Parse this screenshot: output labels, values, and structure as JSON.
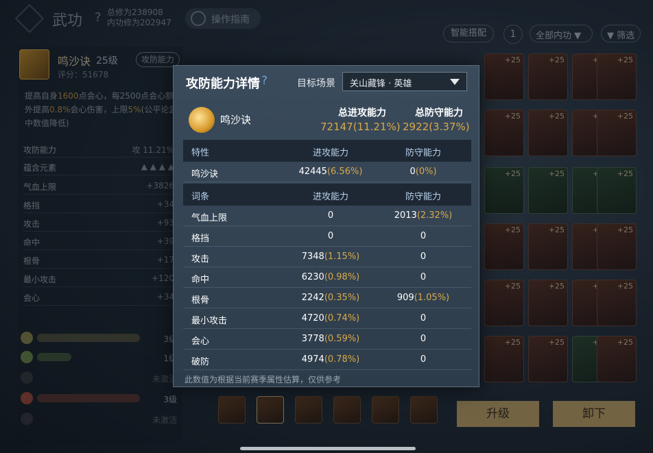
{
  "header": {
    "title": "武功",
    "help": "?",
    "total_cultivation": "总修为238908",
    "inner_cultivation": "内功修为202947",
    "guide": "操作指南"
  },
  "toolbar": {
    "smart_match": "智能搭配",
    "sort": "1",
    "all_inner": "全部内功",
    "filter": "筛选"
  },
  "skill_panel": {
    "name": "鸣沙诀",
    "level": "25级",
    "tag": "攻防能力",
    "score": "评分：51678",
    "desc_prefix": "提高自身",
    "desc_v1": "1600",
    "desc_mid": "点会心，每2500点会心额外提高",
    "desc_v2": "0.8%",
    "desc_mid2": "会心伤害，上限",
    "desc_v3": "5%",
    "desc_suffix": "(公平论武中数值降低)",
    "attack_defense_label": "攻防能力",
    "attack_defense_tag": "攻",
    "attack_defense_value": "11.21%",
    "elements_label": "蕴含元素",
    "stats": [
      {
        "k": "气血上限",
        "v": "+3826"
      },
      {
        "k": "格挡",
        "v": "+34"
      },
      {
        "k": "攻击",
        "v": "+93"
      },
      {
        "k": "命中",
        "v": "+39"
      },
      {
        "k": "根骨",
        "v": "+17"
      },
      {
        "k": "最小攻击",
        "v": "+120"
      },
      {
        "k": "会心",
        "v": "+34"
      }
    ],
    "badges": [
      {
        "right": "3级"
      },
      {
        "right": "1级"
      },
      {
        "right": "未激活"
      },
      {
        "right": "3级"
      },
      {
        "right": "未激活"
      }
    ]
  },
  "cards": {
    "plus": "+25"
  },
  "actions": {
    "upgrade": "升级",
    "unload": "卸下"
  },
  "modal": {
    "title": "攻防能力详情",
    "help": "?",
    "scene_label": "目标场景",
    "scene_value": "关山藏锋 · 英雄",
    "skill_name": "鸣沙诀",
    "total_attack_label": "总进攻能力",
    "total_defense_label": "总防守能力",
    "total_attack_value": "72147",
    "total_attack_pct": "(11.21%)",
    "total_defense_value": "2922",
    "total_defense_pct": "(3.37%)",
    "trait_header": {
      "c1": "特性",
      "c2": "进攻能力",
      "c3": "防守能力"
    },
    "trait_row": {
      "name": "鸣沙诀",
      "atk": "42445",
      "atk_pct": "(6.56%)",
      "def": "0",
      "def_pct": "(0%)"
    },
    "entry_header": {
      "c1": "词条",
      "c2": "进攻能力",
      "c3": "防守能力"
    },
    "entries": [
      {
        "name": "气血上限",
        "atk": "0",
        "atk_pct": "",
        "def": "2013",
        "def_pct": "(2.32%)"
      },
      {
        "name": "格挡",
        "atk": "0",
        "atk_pct": "",
        "def": "0",
        "def_pct": ""
      },
      {
        "name": "攻击",
        "atk": "7348",
        "atk_pct": "(1.15%)",
        "def": "0",
        "def_pct": ""
      },
      {
        "name": "命中",
        "atk": "6230",
        "atk_pct": "(0.98%)",
        "def": "0",
        "def_pct": ""
      },
      {
        "name": "根骨",
        "atk": "2242",
        "atk_pct": "(0.35%)",
        "def": "909",
        "def_pct": "(1.05%)"
      },
      {
        "name": "最小攻击",
        "atk": "4720",
        "atk_pct": "(0.74%)",
        "def": "0",
        "def_pct": ""
      },
      {
        "name": "会心",
        "atk": "3778",
        "atk_pct": "(0.59%)",
        "def": "0",
        "def_pct": ""
      },
      {
        "name": "破防",
        "atk": "4974",
        "atk_pct": "(0.78%)",
        "def": "0",
        "def_pct": ""
      }
    ],
    "footnote": "此数值为根据当前赛季属性估算，仅供参考"
  }
}
